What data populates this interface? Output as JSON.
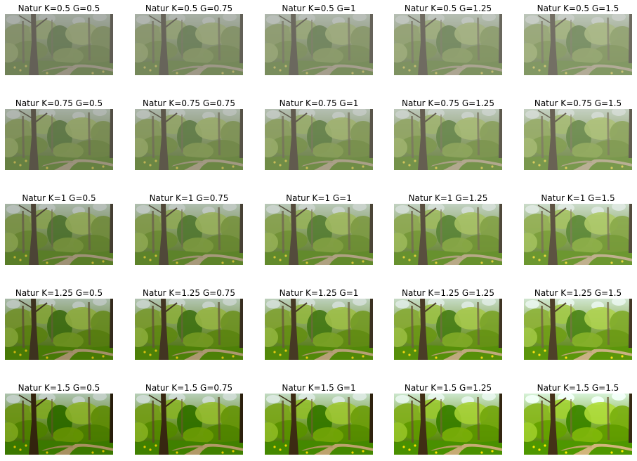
{
  "figure": {
    "panels": [
      {
        "title": "Natur K=0.5 G=0.5",
        "k": 0.5,
        "g": 0.5
      },
      {
        "title": "Natur K=0.5 G=0.75",
        "k": 0.5,
        "g": 0.75
      },
      {
        "title": "Natur K=0.5 G=1",
        "k": 0.5,
        "g": 1
      },
      {
        "title": "Natur K=0.5 G=1.25",
        "k": 0.5,
        "g": 1.25
      },
      {
        "title": "Natur K=0.5 G=1.5",
        "k": 0.5,
        "g": 1.5
      },
      {
        "title": "Natur K=0.75 G=0.5",
        "k": 0.75,
        "g": 0.5
      },
      {
        "title": "Natur K=0.75 G=0.75",
        "k": 0.75,
        "g": 0.75
      },
      {
        "title": "Natur K=0.75 G=1",
        "k": 0.75,
        "g": 1
      },
      {
        "title": "Natur K=0.75 G=1.25",
        "k": 0.75,
        "g": 1.25
      },
      {
        "title": "Natur K=0.75 G=1.5",
        "k": 0.75,
        "g": 1.5
      },
      {
        "title": "Natur K=1 G=0.5",
        "k": 1,
        "g": 0.5
      },
      {
        "title": "Natur K=1 G=0.75",
        "k": 1,
        "g": 0.75
      },
      {
        "title": "Natur K=1 G=1",
        "k": 1,
        "g": 1
      },
      {
        "title": "Natur K=1 G=1.25",
        "k": 1,
        "g": 1.25
      },
      {
        "title": "Natur K=1 G=1.5",
        "k": 1,
        "g": 1.5
      },
      {
        "title": "Natur K=1.25 G=0.5",
        "k": 1.25,
        "g": 0.5
      },
      {
        "title": "Natur K=1.25 G=0.75",
        "k": 1.25,
        "g": 0.75
      },
      {
        "title": "Natur K=1.25 G=1",
        "k": 1.25,
        "g": 1
      },
      {
        "title": "Natur K=1.25 G=1.25",
        "k": 1.25,
        "g": 1.25
      },
      {
        "title": "Natur K=1.25 G=1.5",
        "k": 1.25,
        "g": 1.5
      },
      {
        "title": "Natur K=1.5 G=0.5",
        "k": 1.5,
        "g": 0.5
      },
      {
        "title": "Natur K=1.5 G=0.75",
        "k": 1.5,
        "g": 0.75
      },
      {
        "title": "Natur K=1.5 G=1",
        "k": 1.5,
        "g": 1
      },
      {
        "title": "Natur K=1.5 G=1.25",
        "k": 1.5,
        "g": 1.25
      },
      {
        "title": "Natur K=1.5 G=1.5",
        "k": 1.5,
        "g": 1.5
      }
    ]
  }
}
